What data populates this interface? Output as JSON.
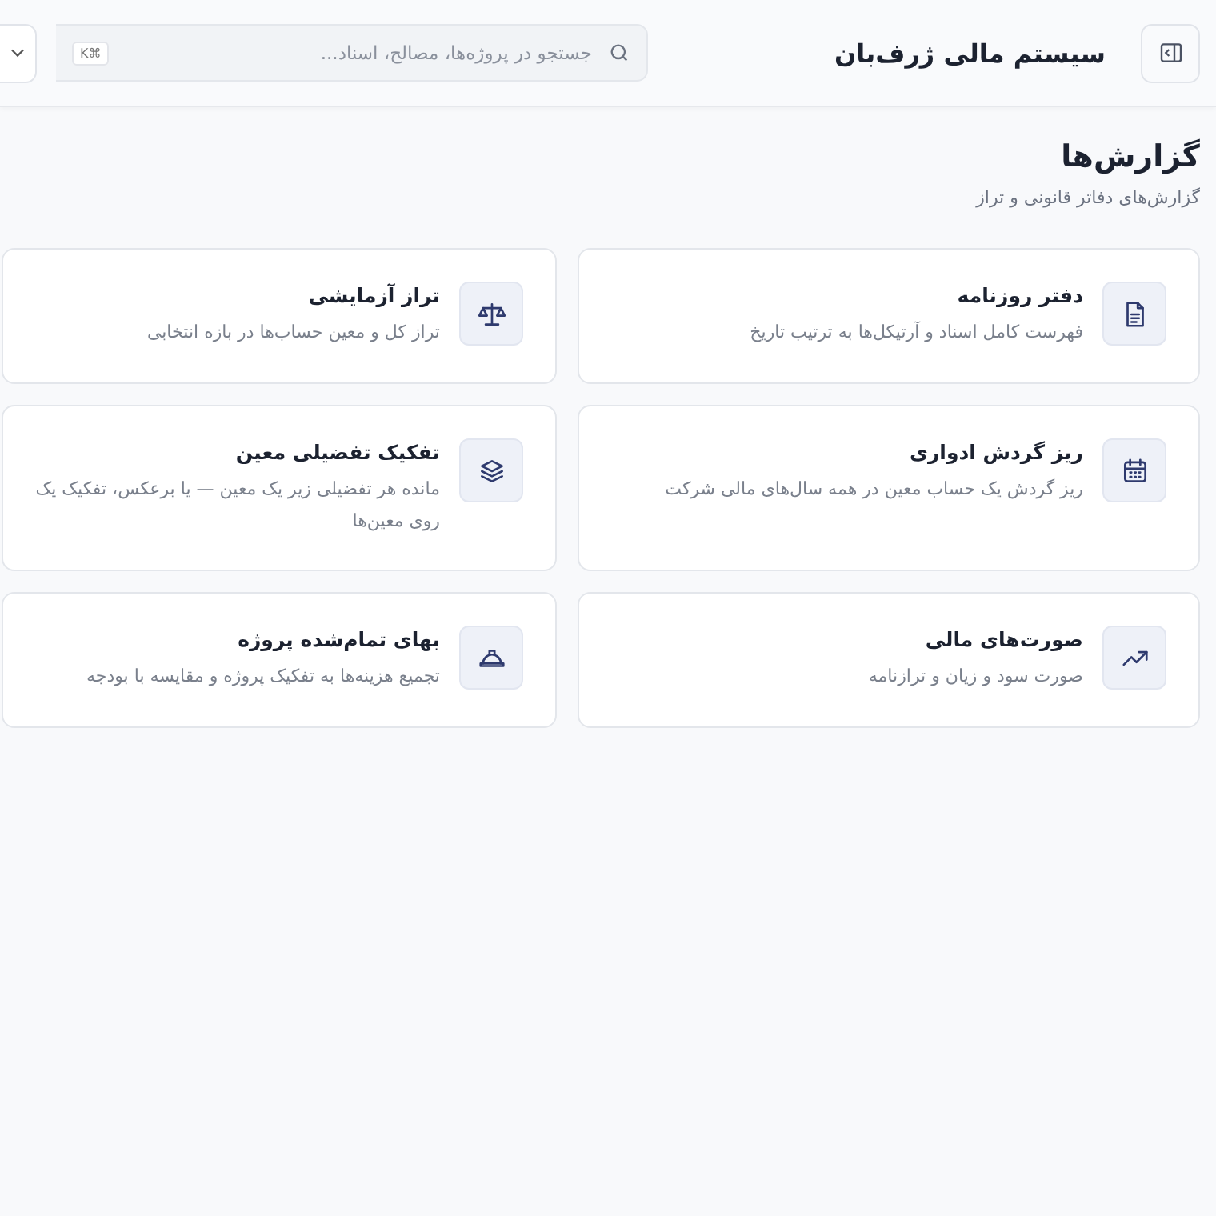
{
  "header": {
    "title": "سیستم مالی ژرف‌بان",
    "search": {
      "placeholder": "جستجو در پروژه‌ها، مصالح، اسناد...",
      "shortcut": "K⌘"
    }
  },
  "page": {
    "title": "گزارش‌ها",
    "subtitle": "گزارش‌های دفاتر قانونی و تراز"
  },
  "cards": [
    {
      "kind": "document",
      "title": "دفتر روزنامه",
      "lines": [
        "فهرست کامل اسناد و آرتیکل‌ها به ترتیب تاریخ"
      ]
    },
    {
      "kind": "scale",
      "title": "تراز آزمایشی",
      "lines": [
        "تراز کل و معین حساب‌ها در بازه انتخابی"
      ]
    },
    {
      "kind": "calendar",
      "title": "ریز گردش ادواری",
      "lines": [
        "ریز گردش یک حساب معین در همه سال‌های مالی شرکت"
      ]
    },
    {
      "kind": "layers",
      "title": "تفکیک تفضیلی معین",
      "lines": [
        "مانده هر تفضیلی زیر یک معین — یا برعکس، تفکیک یک",
        "روی معین‌ها"
      ]
    },
    {
      "kind": "trend",
      "title": "صورت‌های مالی",
      "lines": [
        "صورت سود و زیان و ترازنامه"
      ]
    },
    {
      "kind": "hardhat",
      "title": "بهای تمام‌شده پروژه",
      "lines": [
        "تجمیع هزینه‌ها به تفکیک پروژه و مقایسه با بودجه"
      ]
    }
  ]
}
